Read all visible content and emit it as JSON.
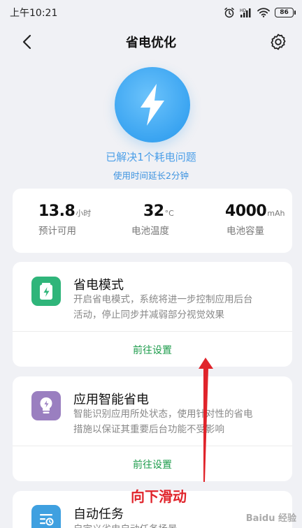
{
  "status_bar": {
    "time": "上午10:21",
    "battery": "86"
  },
  "header": {
    "title": "省电优化"
  },
  "hero": {
    "title": "已解决1个耗电问题",
    "subtitle": "使用时间延长2分钟"
  },
  "stats": [
    {
      "value": "13.8",
      "unit": "小时",
      "label": "预计可用"
    },
    {
      "value": "32",
      "unit": "°C",
      "label": "电池温度"
    },
    {
      "value": "4000",
      "unit": "mAh",
      "label": "电池容量"
    }
  ],
  "features": [
    {
      "title": "省电模式",
      "desc_line1": "开启省电模式，系统将进一步控制应用后台",
      "desc_line2": "活动，停止同步并减弱部分视觉效果",
      "action": "前往设置",
      "icon_color": "#2fb57a"
    },
    {
      "title": "应用智能省电",
      "desc_line1": "智能识别应用所处状态，使用针对性的省电",
      "desc_line2": "措施以保证其重要后台功能不受影响",
      "action": "前往设置",
      "icon_color": "#9a7fc0"
    },
    {
      "title": "自动任务",
      "desc_line1": "自定义省电自动任务场景",
      "icon_color": "#3fa0e0"
    }
  ],
  "annotation": {
    "text": "向下滑动"
  },
  "watermark": {
    "text": "Baidu 经验"
  }
}
